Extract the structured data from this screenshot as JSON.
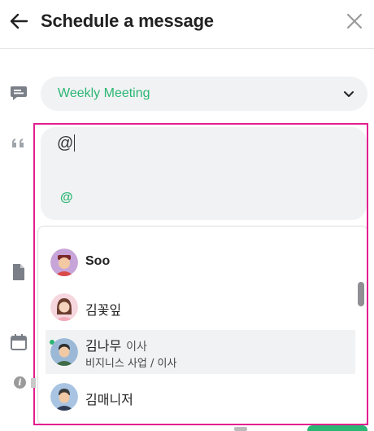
{
  "header": {
    "title": "Schedule a message"
  },
  "topic_select": {
    "value": "Weekly Meeting"
  },
  "message": {
    "text": "@",
    "mention_button": "@"
  },
  "mention_list": {
    "items": [
      {
        "name": "Soo",
        "role": "",
        "subtitle": "",
        "online": false,
        "selected": false
      },
      {
        "name": "김꽃잎",
        "role": "",
        "subtitle": "",
        "online": false,
        "selected": false
      },
      {
        "name": "김나무",
        "role": "이사",
        "subtitle": "비지니스 사업 / 이사",
        "online": true,
        "selected": true
      },
      {
        "name": "김매니저",
        "role": "",
        "subtitle": "",
        "online": false,
        "selected": false
      }
    ]
  },
  "colors": {
    "accent": "#2bb673",
    "highlight": "#e21f8f",
    "field_bg": "#f1f2f4"
  },
  "icons": {
    "back": "arrow-left-icon",
    "close": "close-x-icon",
    "topic": "chat-bubble-icon",
    "message": "quote-icon",
    "file": "file-icon",
    "date": "calendar-icon",
    "info": "info-icon"
  }
}
